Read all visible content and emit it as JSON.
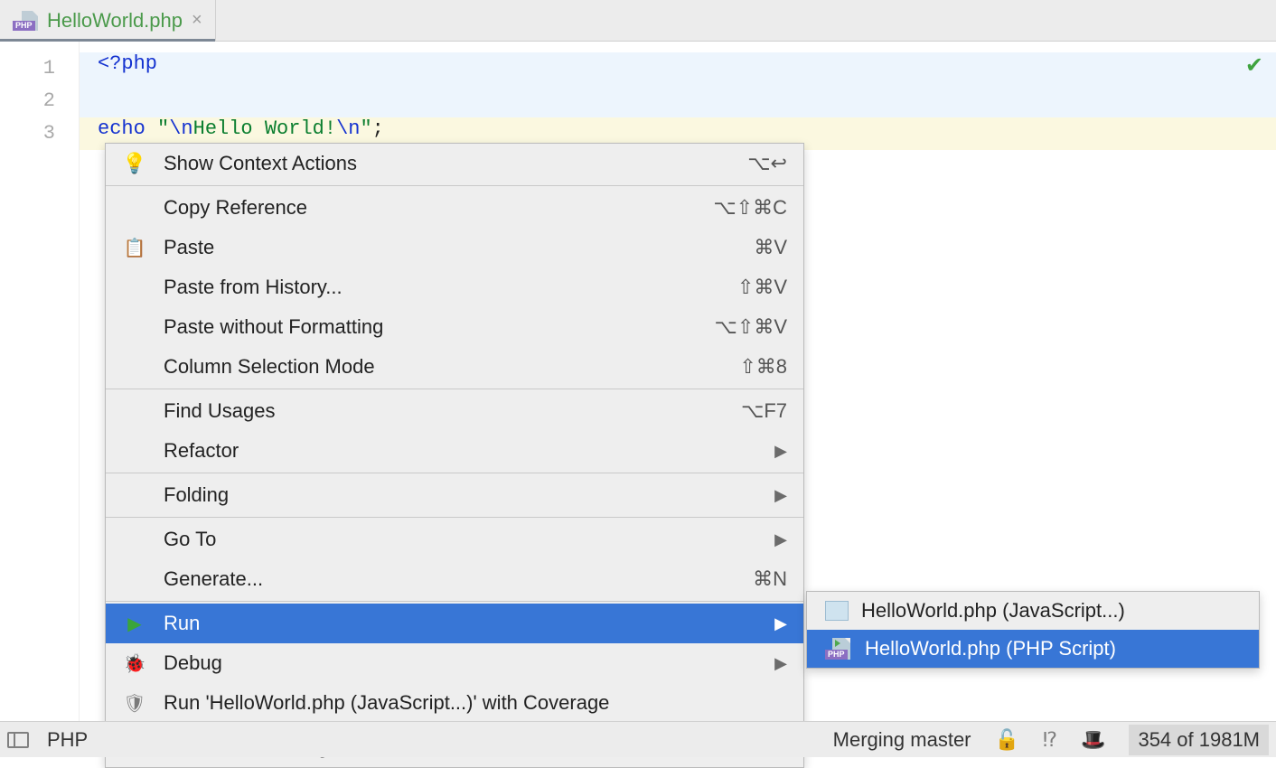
{
  "tab": {
    "filename": "HelloWorld.php",
    "icon_badge": "PHP"
  },
  "gutter": {
    "l1": "1",
    "l2": "2",
    "l3": "3"
  },
  "code": {
    "l1": "<?php",
    "l3_echo": "echo",
    "l3_q1": " \"",
    "l3_esc1": "\\n",
    "l3_mid": "Hello World!",
    "l3_esc2": "\\n",
    "l3_q2": "\"",
    "l3_semi": ";"
  },
  "menu": {
    "show_ctx": "Show Context Actions",
    "show_ctx_sc": "⌥↩",
    "copy_ref": "Copy Reference",
    "copy_ref_sc": "⌥⇧⌘C",
    "paste": "Paste",
    "paste_sc": "⌘V",
    "paste_hist": "Paste from History...",
    "paste_hist_sc": "⇧⌘V",
    "paste_nofmt": "Paste without Formatting",
    "paste_nofmt_sc": "⌥⇧⌘V",
    "col_mode": "Column Selection Mode",
    "col_mode_sc": "⇧⌘8",
    "find_usages": "Find Usages",
    "find_usages_sc": "⌥F7",
    "refactor": "Refactor",
    "folding": "Folding",
    "goto": "Go To",
    "generate": "Generate...",
    "generate_sc": "⌘N",
    "run": "Run",
    "debug": "Debug",
    "run_cov": "Run 'HelloWorld.php (JavaScript...)' with Coverage",
    "create_cfg": "Create Run Configuration"
  },
  "submenu": {
    "js": "HelloWorld.php (JavaScript...)",
    "php": "HelloWorld.php (PHP Script)",
    "php_badge": "PHP"
  },
  "status": {
    "php_text": "PHP ",
    "merging": "Merging master",
    "mem": "354 of 1981M"
  }
}
